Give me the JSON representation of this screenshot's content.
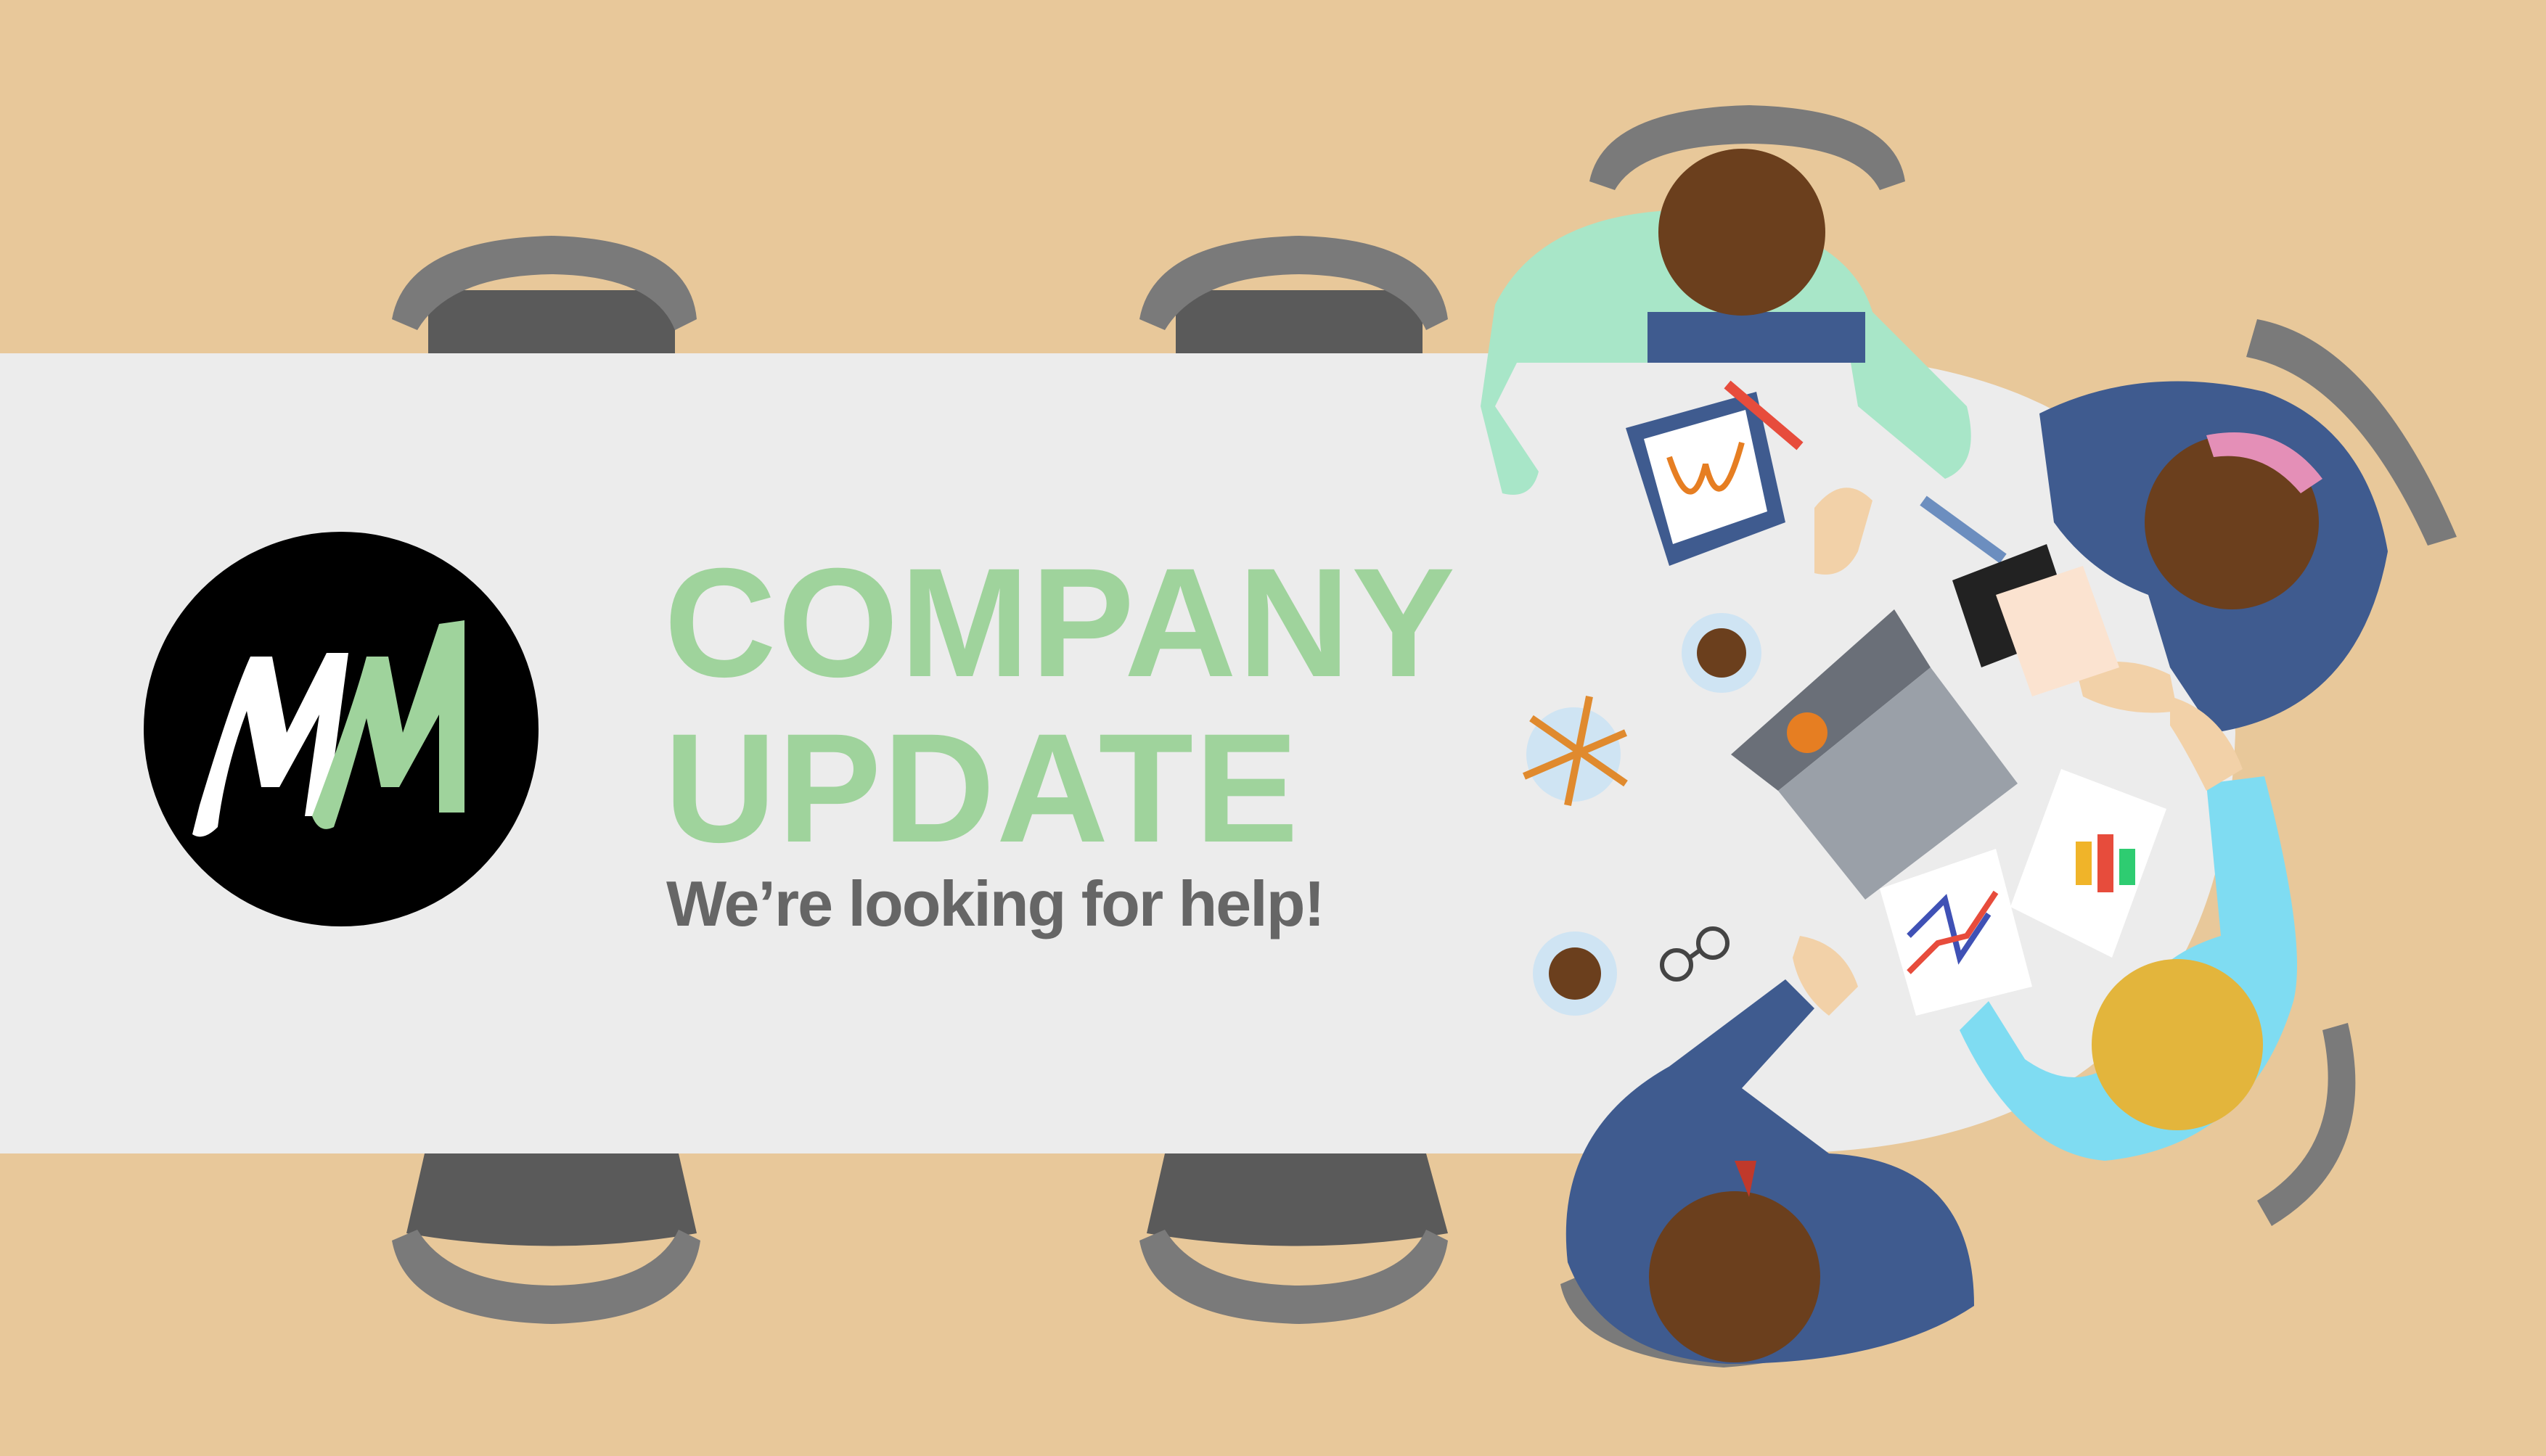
{
  "banner": {
    "logo": {
      "text": "MM",
      "name": "mm-logo"
    },
    "title_line1": "COMPANY",
    "title_line2": "UPDATE",
    "tagline": "We’re looking for help!"
  },
  "icons": [
    "chair-icon",
    "person-icon",
    "laptop-icon",
    "coffee-cup-icon",
    "pencil-cup-icon",
    "clipboard-icon",
    "notebook-icon",
    "pen-icon",
    "glasses-icon",
    "chart-document-icon"
  ],
  "colors": {
    "background": "#e8c89a",
    "table": "#ececec",
    "accent_green": "#9fd39c",
    "tagline_gray": "#666666",
    "chair_dark": "#5a5a5a",
    "chair_back": "#7a7a7a",
    "suit_blue": "#3f5b8f",
    "shirt_mint": "#a8e6c8",
    "shirt_cyan": "#7fdcf2",
    "hair_brown": "#6b3f1d",
    "hair_blonde": "#e3b53c",
    "skin": "#f2d1a8"
  }
}
